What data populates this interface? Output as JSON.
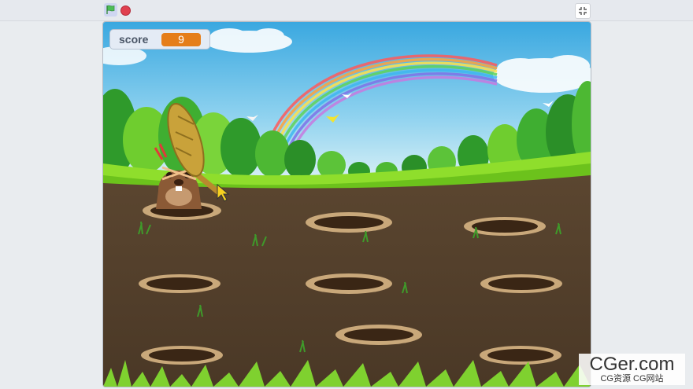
{
  "toolbar": {
    "green_flag_icon": "green-flag-icon",
    "stop_icon": "stop-sign-icon",
    "fullscreen_icon": "exit-fullscreen-icon"
  },
  "monitor": {
    "label": "score",
    "value": "9"
  },
  "watermark": {
    "main": "CGer.com",
    "sub": "CG资源 CG网站"
  },
  "colors": {
    "score_value_bg": "#e57e1a",
    "stop_red": "#e0404f",
    "flag_green": "#4cbf56"
  }
}
